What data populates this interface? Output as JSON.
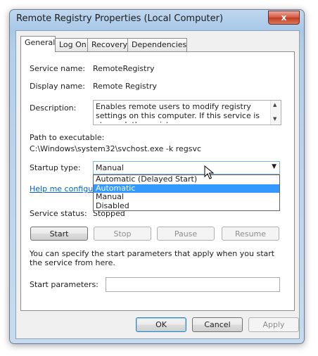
{
  "window": {
    "title": "Remote Registry Properties (Local Computer)",
    "close_glyph": "x"
  },
  "tabs": [
    {
      "label": "General",
      "active": true
    },
    {
      "label": "Log On"
    },
    {
      "label": "Recovery"
    },
    {
      "label": "Dependencies"
    }
  ],
  "general": {
    "service_name_label": "Service name:",
    "service_name_value": "RemoteRegistry",
    "display_name_label": "Display name:",
    "display_name_value": "Remote Registry",
    "description_label": "Description:",
    "description_value": "Enables remote users to modify registry settings on this computer. If this service is stopped, the registry",
    "path_label": "Path to executable:",
    "path_value": "C:\\Windows\\system32\\svchost.exe -k regsvc",
    "startup_type_label": "Startup type:",
    "startup_type_value": "Manual",
    "startup_options": [
      "Automatic (Delayed Start)",
      "Automatic",
      "Manual",
      "Disabled"
    ],
    "highlighted_option": "Automatic",
    "help_link": "Help me configure",
    "service_status_label": "Service status:",
    "service_status_value": "Stopped",
    "buttons": {
      "start": "Start",
      "stop": "Stop",
      "pause": "Pause",
      "resume": "Resume"
    },
    "start_params_info": "You can specify the start parameters that apply when you start the service from here.",
    "start_params_label": "Start parameters:",
    "start_params_value": ""
  },
  "footer": {
    "ok": "OK",
    "cancel": "Cancel",
    "apply": "Apply"
  },
  "colors": {
    "selection": "#3399ff",
    "link": "#0066cc",
    "close": "#c23a22"
  }
}
